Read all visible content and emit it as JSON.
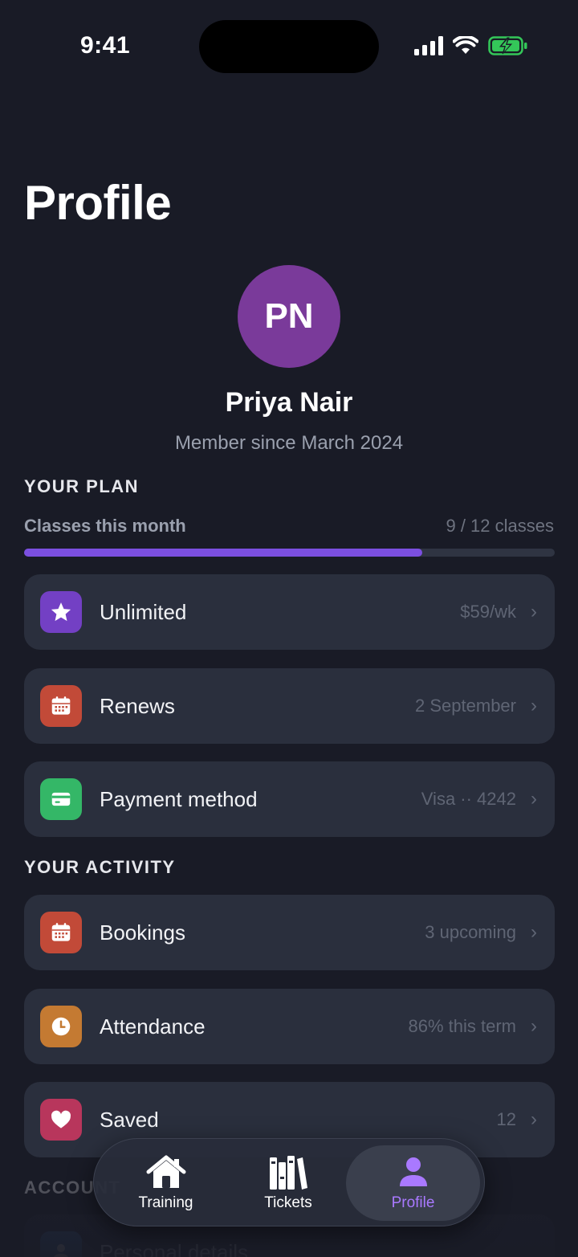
{
  "status_bar": {
    "time": "9:41"
  },
  "page": {
    "title": "Profile"
  },
  "profile": {
    "initials": "PN",
    "name": "Priya Nair",
    "member_since": "Member since March 2024",
    "avatar_color": "#7a3a9a"
  },
  "plan": {
    "header": "YOUR PLAN",
    "progress_label": "Classes this month",
    "progress_value": "9 / 12 classes",
    "progress_fraction": 0.75,
    "items": [
      {
        "label": "Unlimited",
        "value": "$59/wk",
        "icon": "star-icon",
        "color": "#7340c4"
      },
      {
        "label": "Renews",
        "value": "2 September",
        "icon": "calendar-icon",
        "color": "#c24a38"
      },
      {
        "label": "Payment method",
        "value": "Visa ·· 4242",
        "icon": "credit-card-icon",
        "color": "#34b767"
      }
    ]
  },
  "activity": {
    "header": "YOUR ACTIVITY",
    "items": [
      {
        "label": "Bookings",
        "value": "3 upcoming",
        "icon": "calendar-icon",
        "color": "#c24a38"
      },
      {
        "label": "Attendance",
        "value": "86% this term",
        "icon": "clock-icon",
        "color": "#c47a32"
      },
      {
        "label": "Saved",
        "value": "12",
        "icon": "heart-icon",
        "color": "#b8365c"
      }
    ]
  },
  "account": {
    "header": "ACCOUNT",
    "items": [
      {
        "label": "Personal details",
        "icon": "person-icon",
        "color": "#3a6fb0"
      }
    ]
  },
  "tab_bar": {
    "tabs": [
      {
        "label": "Training",
        "icon": "home-icon"
      },
      {
        "label": "Tickets",
        "icon": "books-icon"
      },
      {
        "label": "Profile",
        "icon": "person-icon",
        "active": true
      }
    ],
    "active_color": "#a979ff"
  }
}
